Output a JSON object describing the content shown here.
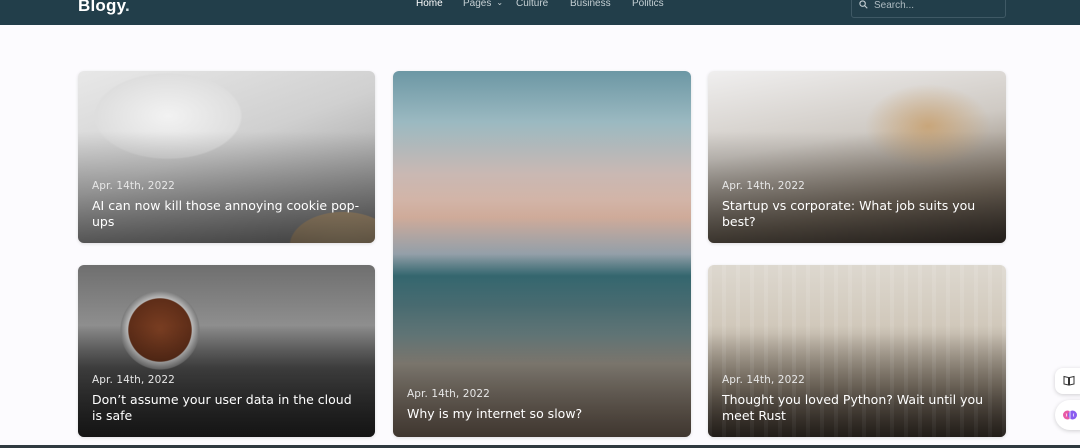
{
  "header": {
    "logo": "Blogy",
    "logo_dot": ".",
    "nav": {
      "home": "Home",
      "pages": "Pages",
      "culture": "Culture",
      "business": "Business",
      "politics": "Politics"
    },
    "search": {
      "placeholder": "Search..."
    }
  },
  "posts": [
    {
      "date": "Apr. 14th, 2022",
      "title": "AI can now kill those annoying cookie pop-ups"
    },
    {
      "date": "Apr. 14th, 2022",
      "title": "Why is my internet so slow?"
    },
    {
      "date": "Apr. 14th, 2022",
      "title": "Startup vs corporate: What job suits you best?"
    },
    {
      "date": "Apr. 14th, 2022",
      "title": "Don’t assume your user data in the cloud is safe"
    },
    {
      "date": "Apr. 14th, 2022",
      "title": "Thought you loved Python? Wait until you meet Rust"
    }
  ],
  "colors": {
    "header_bg": "#223e4a",
    "page_bg": "#fcfbfe"
  },
  "icons": {
    "search": "search-icon",
    "pages_dropdown": "chevron-down-icon",
    "reader": "book-icon",
    "brain": "brain-icon"
  }
}
